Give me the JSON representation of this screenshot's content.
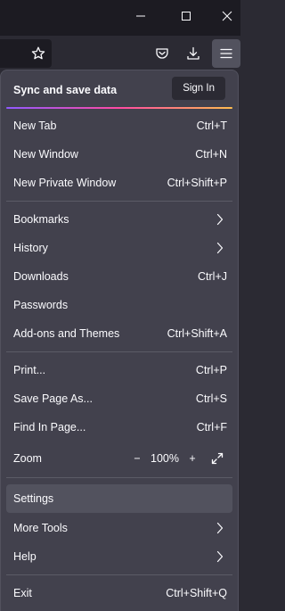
{
  "window_controls": {
    "minimize_icon": "minimize-icon",
    "maximize_icon": "maximize-icon",
    "close_icon": "close-icon"
  },
  "toolbar": {
    "icons": [
      "bookmark-star-icon",
      "pocket-icon",
      "downloads-icon",
      "hamburger-menu-icon"
    ]
  },
  "menu": {
    "sync_label": "Sync and save data",
    "sign_in": "Sign In",
    "groups": [
      [
        {
          "label": "New Tab",
          "shortcut": "Ctrl+T"
        },
        {
          "label": "New Window",
          "shortcut": "Ctrl+N"
        },
        {
          "label": "New Private Window",
          "shortcut": "Ctrl+Shift+P"
        }
      ],
      [
        {
          "label": "Bookmarks",
          "submenu": true
        },
        {
          "label": "History",
          "submenu": true
        },
        {
          "label": "Downloads",
          "shortcut": "Ctrl+J"
        },
        {
          "label": "Passwords"
        },
        {
          "label": "Add-ons and Themes",
          "shortcut": "Ctrl+Shift+A"
        }
      ],
      [
        {
          "label": "Print...",
          "shortcut": "Ctrl+P"
        },
        {
          "label": "Save Page As...",
          "shortcut": "Ctrl+S"
        },
        {
          "label": "Find In Page...",
          "shortcut": "Ctrl+F"
        }
      ]
    ],
    "zoom": {
      "label": "Zoom",
      "value": "100%",
      "decrease": "−",
      "increase": "+"
    },
    "settings": "Settings",
    "more_tools": "More Tools",
    "help": "Help",
    "exit": {
      "label": "Exit",
      "shortcut": "Ctrl+Shift+Q"
    }
  },
  "colors": {
    "panel_bg": "#42414d",
    "toolbar_bg": "#2b2a33",
    "titlebar_bg": "#1c1b22",
    "hover_bg": "#52525e",
    "text": "#fbfbfe",
    "accent_gradient": [
      "#9059ff",
      "#ff4aa2",
      "#ffbd4f"
    ]
  }
}
